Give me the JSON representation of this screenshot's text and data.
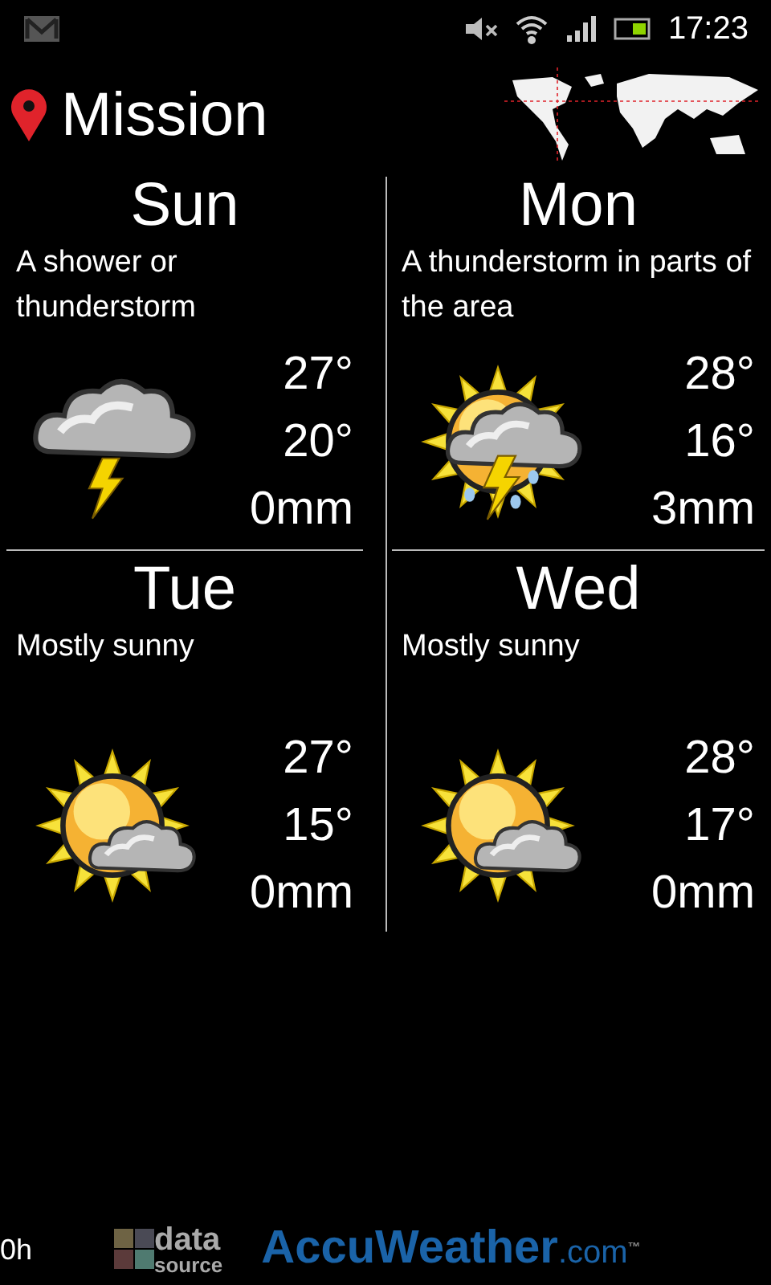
{
  "status_bar": {
    "time": "17:23"
  },
  "location": {
    "name": "Mission"
  },
  "days": [
    {
      "day": "Sun",
      "description": "A shower or thunderstorm",
      "kind": "storm",
      "high": "27°",
      "low": "20°",
      "precip": "0mm"
    },
    {
      "day": "Mon",
      "description": "A thunderstorm in parts of the area",
      "kind": "sun-storm",
      "high": "28°",
      "low": "16°",
      "precip": "3mm"
    },
    {
      "day": "Tue",
      "description": "Mostly sunny",
      "kind": "sun-cloud",
      "high": "27°",
      "low": "15°",
      "precip": "0mm"
    },
    {
      "day": "Wed",
      "description": "Mostly sunny",
      "kind": "sun-cloud",
      "high": "28°",
      "low": "17°",
      "precip": "0mm"
    }
  ],
  "footer": {
    "age": "0h",
    "source_logo": {
      "line1": "data",
      "line2": "source"
    },
    "brand": {
      "name": "AccuWeather",
      "suffix": ".com",
      "tm": "™"
    }
  }
}
